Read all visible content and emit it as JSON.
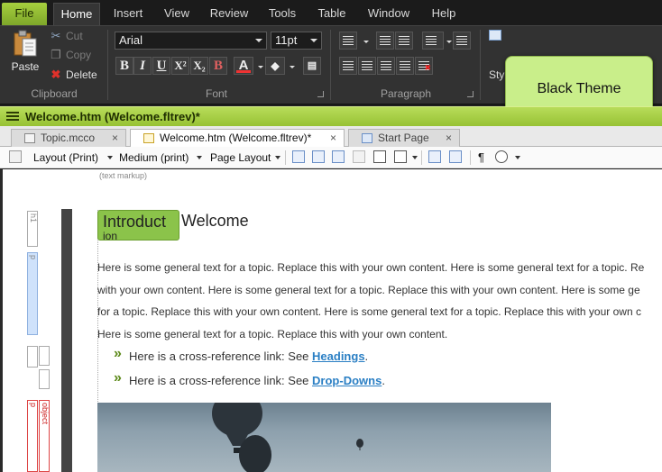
{
  "menubar": {
    "tabs": [
      "File",
      "Home",
      "Insert",
      "View",
      "Review",
      "Tools",
      "Table",
      "Window",
      "Help"
    ]
  },
  "ribbon": {
    "clipboard": {
      "paste": "Paste",
      "cut": "Cut",
      "copy": "Copy",
      "delete": "Delete",
      "label": "Clipboard"
    },
    "font": {
      "family": "Arial",
      "size": "11pt",
      "label": "Font",
      "buttons": [
        "B",
        "I",
        "U",
        "X²",
        "X₂",
        "B"
      ]
    },
    "paragraph": {
      "label": "Paragraph"
    },
    "styles": {
      "label": "Sty"
    },
    "theme_badge": "Black Theme"
  },
  "document": {
    "window_title": "Welcome.htm (Welcome.fltrev)*",
    "tabs": [
      {
        "label": "Topic.mcco",
        "close": "×",
        "active": false
      },
      {
        "label": "Welcome.htm (Welcome.fltrev)*",
        "close": "×",
        "active": true
      },
      {
        "label": "Start Page",
        "close": "×",
        "active": false
      }
    ],
    "toolbar": {
      "layout": "Layout (Print)",
      "medium": "Medium (print)",
      "page_layout": "Page Layout",
      "pilcrow": "¶"
    },
    "markup_label": "(text markup)",
    "structure": {
      "h1": "h1",
      "p": "p",
      "object": "object"
    },
    "heading_tag": "Introduct",
    "heading_tag_overflow": "ion",
    "heading_text": "Welcome",
    "paragraph_lines": [
      "Here is some general text for a topic. Replace this with your own content. Here is some general text for a topic. Re",
      "with your own content. Here is some general text for a topic. Replace this with your own content. Here is some ge",
      "for a topic. Replace this with your own content. Here is some general text for a topic. Replace this with your own c",
      "Here is some general text for a topic. Replace this with your own content."
    ],
    "bullets": [
      {
        "prefix": "Here is a cross-reference link: See ",
        "link": "Headings",
        "suffix": "."
      },
      {
        "prefix": "Here is a cross-reference link: See ",
        "link": "Drop-Downs",
        "suffix": "."
      }
    ]
  },
  "colors": {
    "accent": "#97c234",
    "theme_badge": "#c9ee8a",
    "link": "#2a7fc4",
    "heading_tag": "#8bc34a"
  }
}
